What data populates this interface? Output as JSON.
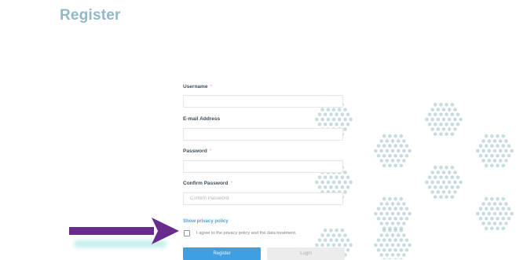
{
  "page": {
    "title": "Register"
  },
  "form": {
    "username": {
      "label": "Username",
      "required": "*",
      "value": ""
    },
    "email": {
      "label": "E-mail Address",
      "value": ""
    },
    "password": {
      "label": "Password",
      "required": "*",
      "value": ""
    },
    "confirm_password": {
      "label": "Confirm Password",
      "required": "*",
      "placeholder": "Confirm Password",
      "value": ""
    },
    "privacy_link": "Show privacy policy",
    "agree_text": "I agree to the privacy policy and the data treatment.",
    "agree_checked": false,
    "register_button": "Register",
    "login_button": "Login"
  },
  "colors": {
    "title": "#8fb8c9",
    "primary_button": "#3f9fe0",
    "secondary_button": "#ececec",
    "link": "#4f9fd6",
    "arrow": "#6a2c8c",
    "dot_pattern": "#b8d3d8"
  }
}
